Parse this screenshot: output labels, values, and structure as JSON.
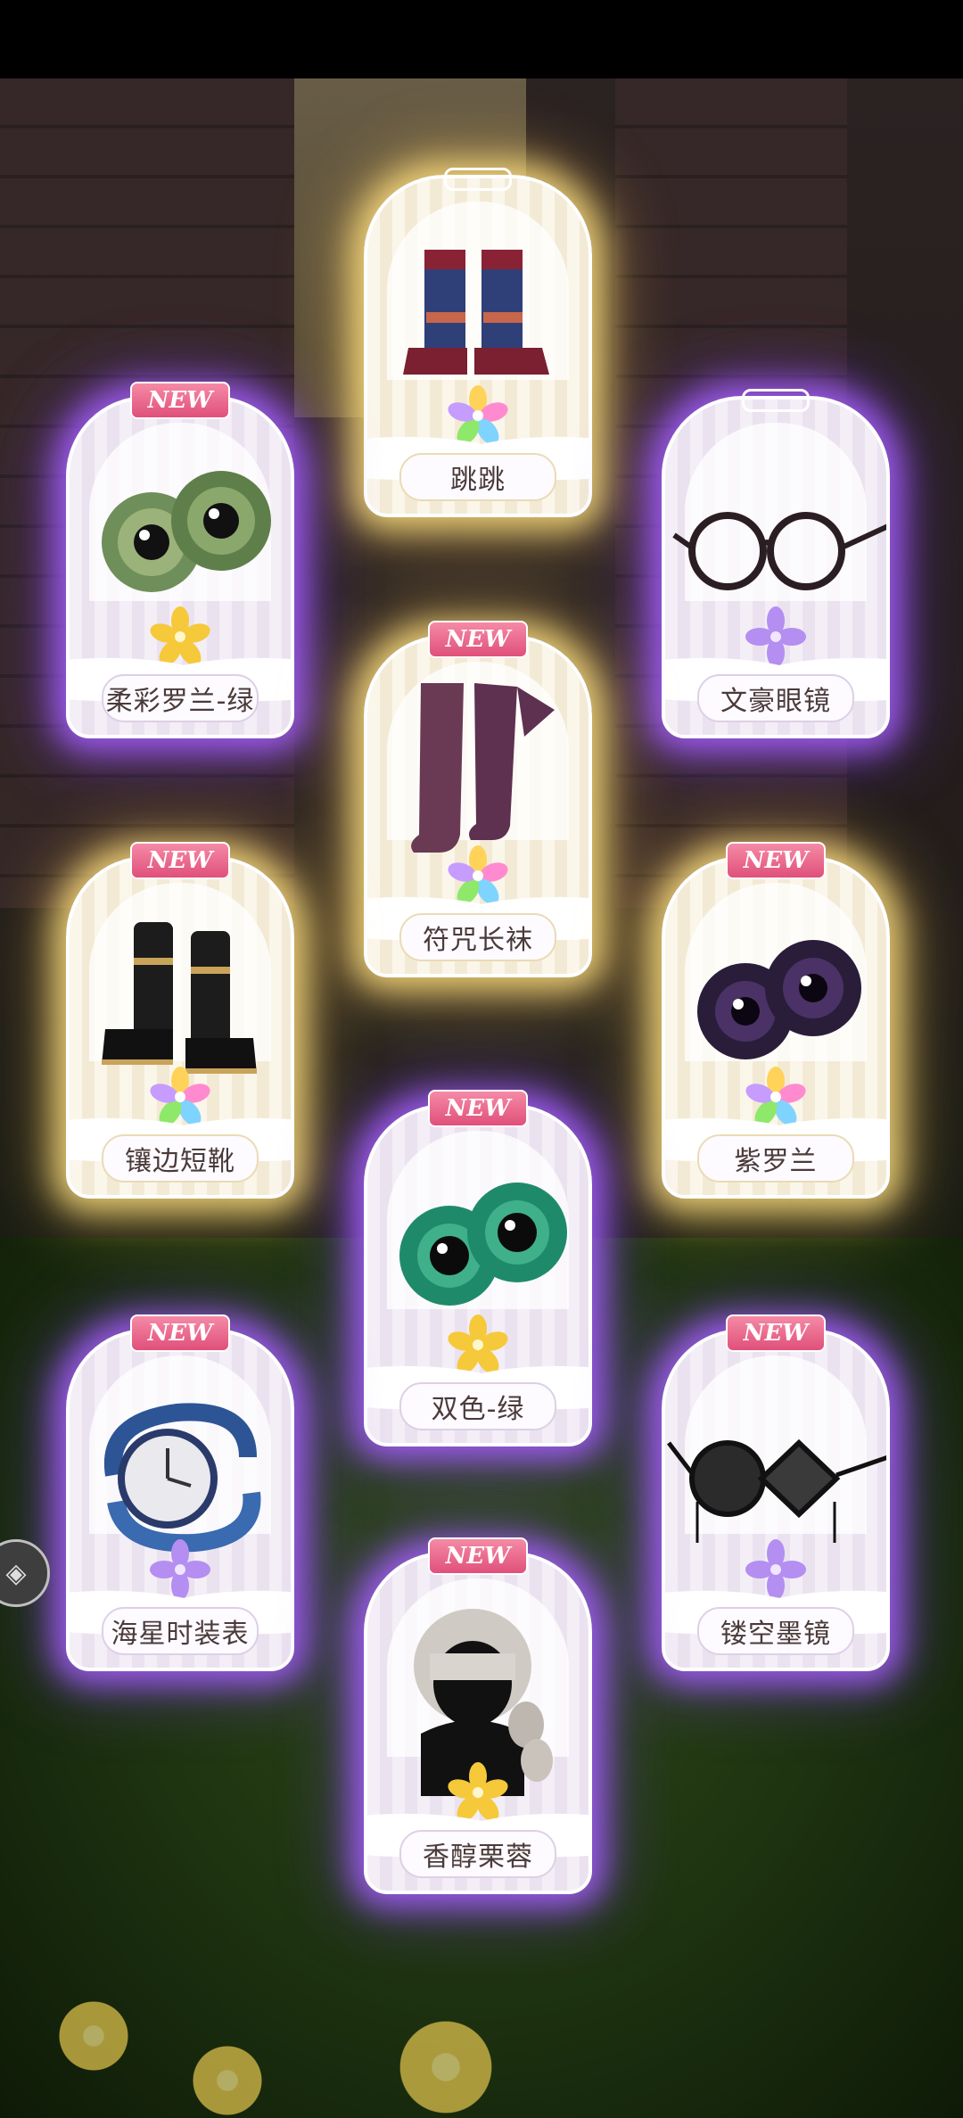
{
  "items": [
    {
      "name": "跳跳",
      "is_new": false,
      "rarity": "rainbow",
      "frame": "gold",
      "icon": "boots-icon"
    },
    {
      "name": "柔彩罗兰-绿",
      "is_new": true,
      "rarity": "gold",
      "frame": "purple",
      "icon": "eyes-icon"
    },
    {
      "name": "文豪眼镜",
      "is_new": false,
      "rarity": "purple",
      "frame": "purple",
      "icon": "glasses-icon"
    },
    {
      "name": "符咒长袜",
      "is_new": true,
      "rarity": "rainbow",
      "frame": "gold",
      "icon": "stockings-icon"
    },
    {
      "name": "镶边短靴",
      "is_new": true,
      "rarity": "rainbow",
      "frame": "gold",
      "icon": "boots-icon"
    },
    {
      "name": "紫罗兰",
      "is_new": true,
      "rarity": "rainbow",
      "frame": "gold",
      "icon": "eyes-icon"
    },
    {
      "name": "双色-绿",
      "is_new": true,
      "rarity": "gold",
      "frame": "purple",
      "icon": "eyes-icon"
    },
    {
      "name": "海星时装表",
      "is_new": true,
      "rarity": "purple",
      "frame": "purple",
      "icon": "watch-icon"
    },
    {
      "name": "镂空墨镜",
      "is_new": true,
      "rarity": "purple",
      "frame": "purple",
      "icon": "sunglasses-icon"
    },
    {
      "name": "香醇栗蓉",
      "is_new": true,
      "rarity": "gold",
      "frame": "purple",
      "icon": "hair-icon"
    }
  ],
  "new_badge": "NEW",
  "colors": {
    "purple_glow": "#a860ff",
    "gold_glow": "#ffe282",
    "badge_pink": "#e0507a"
  }
}
